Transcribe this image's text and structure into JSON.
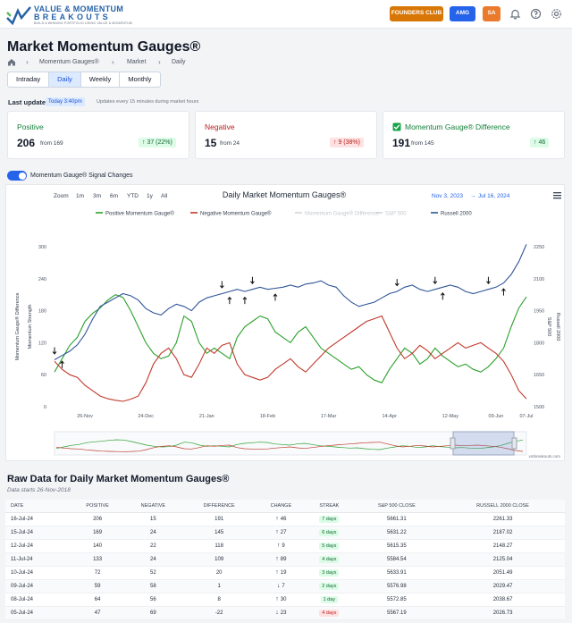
{
  "header": {
    "logo_line1": "VALUE & MOMENTUM",
    "logo_line2": "BREAKOUTS",
    "logo_tagline": "BUILD A WINNING PORTFOLIO USING VALUE & MOMENTUM",
    "founders_label": "FOUNDERS CLUB",
    "amg_label": "AMG",
    "sa_label": "SA",
    "colors": {
      "founders": "#d97706",
      "amg": "#2563eb",
      "sa": "#ea7a2c"
    }
  },
  "page": {
    "title": "Market Momentum Gauges®",
    "breadcrumbs": [
      "Momentum Gauges®",
      "Market",
      "Daily"
    ],
    "tabs": [
      "Intraday",
      "Daily",
      "Weekly",
      "Monthly"
    ],
    "active_tab": "Daily"
  },
  "update": {
    "label": "Last update",
    "badge": "Today 3:40pm",
    "note": "Updates every 15 minutes during market hours"
  },
  "cards": {
    "positive": {
      "title": "Positive",
      "value": "206",
      "from": "from 169",
      "change": "37 (22%)",
      "direction": "up"
    },
    "negative": {
      "title": "Negative",
      "value": "15",
      "from": "from 24",
      "change": "9 (38%)",
      "direction": "down"
    },
    "difference": {
      "title": "Momentum Gauge® Difference",
      "value": "191",
      "from": "from 145",
      "change": "46",
      "direction": "up"
    }
  },
  "toggle": {
    "label": "Momentum Gauge® Signal Changes",
    "on": true
  },
  "chart_toolbar": {
    "zoom_label": "Zoom",
    "zoom_buttons": [
      "1m",
      "3m",
      "6m",
      "YTD",
      "1y",
      "All"
    ],
    "date_from": "Nov 3, 2023",
    "date_arrow": "→",
    "date_to": "Jul 16, 2024",
    "credits": "vmbreakouts.com"
  },
  "chart_data": {
    "type": "line",
    "title": "Daily Market Momentum Gauges®",
    "series": [
      {
        "name": "Positive Momentum Gauge®",
        "color": "#2ca02c",
        "axis": "left",
        "visible": true,
        "values": [
          65,
          90,
          115,
          130,
          160,
          175,
          185,
          200,
          210,
          205,
          180,
          150,
          120,
          100,
          90,
          95,
          120,
          170,
          160,
          120,
          100,
          110,
          100,
          90,
          130,
          150,
          160,
          170,
          165,
          140,
          130,
          120,
          140,
          150,
          130,
          110,
          100,
          90,
          80,
          70,
          75,
          60,
          50,
          45,
          70,
          90,
          110,
          100,
          80,
          90,
          110,
          95,
          85,
          75,
          80,
          70,
          65,
          75,
          90,
          110,
          150,
          185,
          206
        ]
      },
      {
        "name": "Negative Momentum Gauge®",
        "color": "#c0392b",
        "axis": "left",
        "visible": true,
        "values": [
          85,
          70,
          60,
          55,
          40,
          30,
          20,
          15,
          12,
          10,
          14,
          20,
          45,
          80,
          100,
          110,
          90,
          60,
          55,
          80,
          110,
          100,
          115,
          120,
          80,
          60,
          55,
          50,
          55,
          70,
          80,
          90,
          75,
          65,
          80,
          95,
          110,
          120,
          130,
          140,
          150,
          160,
          165,
          170,
          140,
          110,
          90,
          100,
          115,
          105,
          90,
          100,
          110,
          120,
          110,
          115,
          120,
          110,
          100,
          85,
          60,
          30,
          15
        ]
      },
      {
        "name": "Momentum Gauge® Difference",
        "color": "#9ca3af",
        "axis": "left",
        "visible": false
      },
      {
        "name": "S&P 500",
        "color": "#d1d5db",
        "axis": "right",
        "visible": false
      },
      {
        "name": "Russell 2000",
        "color": "#2f5597",
        "axis": "right",
        "visible": true,
        "values": [
          1720,
          1740,
          1760,
          1790,
          1840,
          1910,
          1970,
          1990,
          2010,
          2030,
          2020,
          2000,
          1960,
          1940,
          1930,
          1960,
          1980,
          1970,
          1950,
          1990,
          2010,
          2020,
          2030,
          2040,
          2050,
          2040,
          2050,
          2060,
          2050,
          2055,
          2060,
          2070,
          2060,
          2075,
          2080,
          2090,
          2070,
          2060,
          2020,
          1990,
          1970,
          1980,
          1990,
          2010,
          2030,
          2040,
          2060,
          2070,
          2050,
          2040,
          2050,
          2060,
          2070,
          2060,
          2040,
          2030,
          2040,
          2050,
          2060,
          2080,
          2120,
          2180,
          2261
        ]
      }
    ],
    "x_tick_labels": [
      "26-Nov",
      "24-Dec",
      "21-Jan",
      "18-Feb",
      "17-Mar",
      "14-Apr",
      "12-May",
      "09-Jun",
      "07-Jul"
    ],
    "y_left_ticks": [
      0,
      60,
      120,
      180,
      240,
      300
    ],
    "y_right_ticks": [
      1500,
      1650,
      1800,
      1950,
      2100,
      2250
    ],
    "y_left_range": [
      0,
      300
    ],
    "y_right_range": [
      1500,
      2250
    ],
    "y_left_title_outer": "Momentum Gauge® Difference",
    "y_left_title_inner": "Momentum Strength",
    "y_right_title_inner": "S&P 500",
    "y_right_title_outer": "Russell 2000",
    "legend_position": "top",
    "grid": false,
    "signal_markers": [
      {
        "index": 0,
        "dir": "down"
      },
      {
        "index": 1,
        "dir": "up"
      },
      {
        "index": 22,
        "dir": "down"
      },
      {
        "index": 23,
        "dir": "up"
      },
      {
        "index": 25,
        "dir": "up"
      },
      {
        "index": 26,
        "dir": "down"
      },
      {
        "index": 29,
        "dir": "up"
      },
      {
        "index": 45,
        "dir": "down"
      },
      {
        "index": 50,
        "dir": "down"
      },
      {
        "index": 51,
        "dir": "up"
      },
      {
        "index": 57,
        "dir": "down"
      },
      {
        "index": 59,
        "dir": "up"
      }
    ]
  },
  "table": {
    "title": "Raw Data for Daily Market Momentum Gauges®",
    "subtitle": "Data starts 26-Nov-2018",
    "headers": [
      "DATE",
      "POSITIVE",
      "NEGATIVE",
      "DIFFERENCE",
      "CHANGE",
      "STREAK",
      "S&P 500 CLOSE",
      "RUSSELL 2000 CLOSE"
    ],
    "rows": [
      {
        "date": "16-Jul-24",
        "positive": "206",
        "negative": "15",
        "difference": "191",
        "change_dir": "up",
        "change": "46",
        "streak": "7 days",
        "streak_dir": "up",
        "sp500": "5661.31",
        "russell": "2261.33"
      },
      {
        "date": "15-Jul-24",
        "positive": "169",
        "negative": "24",
        "difference": "145",
        "change_dir": "up",
        "change": "27",
        "streak": "6 days",
        "streak_dir": "up",
        "sp500": "5631.22",
        "russell": "2187.02"
      },
      {
        "date": "12-Jul-24",
        "positive": "140",
        "negative": "22",
        "difference": "118",
        "change_dir": "up",
        "change": "9",
        "streak": "5 days",
        "streak_dir": "up",
        "sp500": "5615.35",
        "russell": "2148.27"
      },
      {
        "date": "11-Jul-24",
        "positive": "133",
        "negative": "24",
        "difference": "109",
        "change_dir": "up",
        "change": "89",
        "streak": "4 days",
        "streak_dir": "up",
        "sp500": "5584.54",
        "russell": "2125.04"
      },
      {
        "date": "10-Jul-24",
        "positive": "72",
        "negative": "52",
        "difference": "20",
        "change_dir": "up",
        "change": "19",
        "streak": "3 days",
        "streak_dir": "up",
        "sp500": "5633.91",
        "russell": "2051.49"
      },
      {
        "date": "09-Jul-24",
        "positive": "59",
        "negative": "58",
        "difference": "1",
        "change_dir": "down",
        "change": "7",
        "streak": "2 days",
        "streak_dir": "up",
        "sp500": "5576.98",
        "russell": "2029.47"
      },
      {
        "date": "08-Jul-24",
        "positive": "64",
        "negative": "56",
        "difference": "8",
        "change_dir": "up",
        "change": "30",
        "streak": "1 day",
        "streak_dir": "up",
        "sp500": "5572.85",
        "russell": "2038.67"
      },
      {
        "date": "05-Jul-24",
        "positive": "47",
        "negative": "69",
        "difference": "-22",
        "change_dir": "down",
        "change": "23",
        "streak": "4 days",
        "streak_dir": "down",
        "sp500": "5567.19",
        "russell": "2026.73"
      }
    ]
  }
}
